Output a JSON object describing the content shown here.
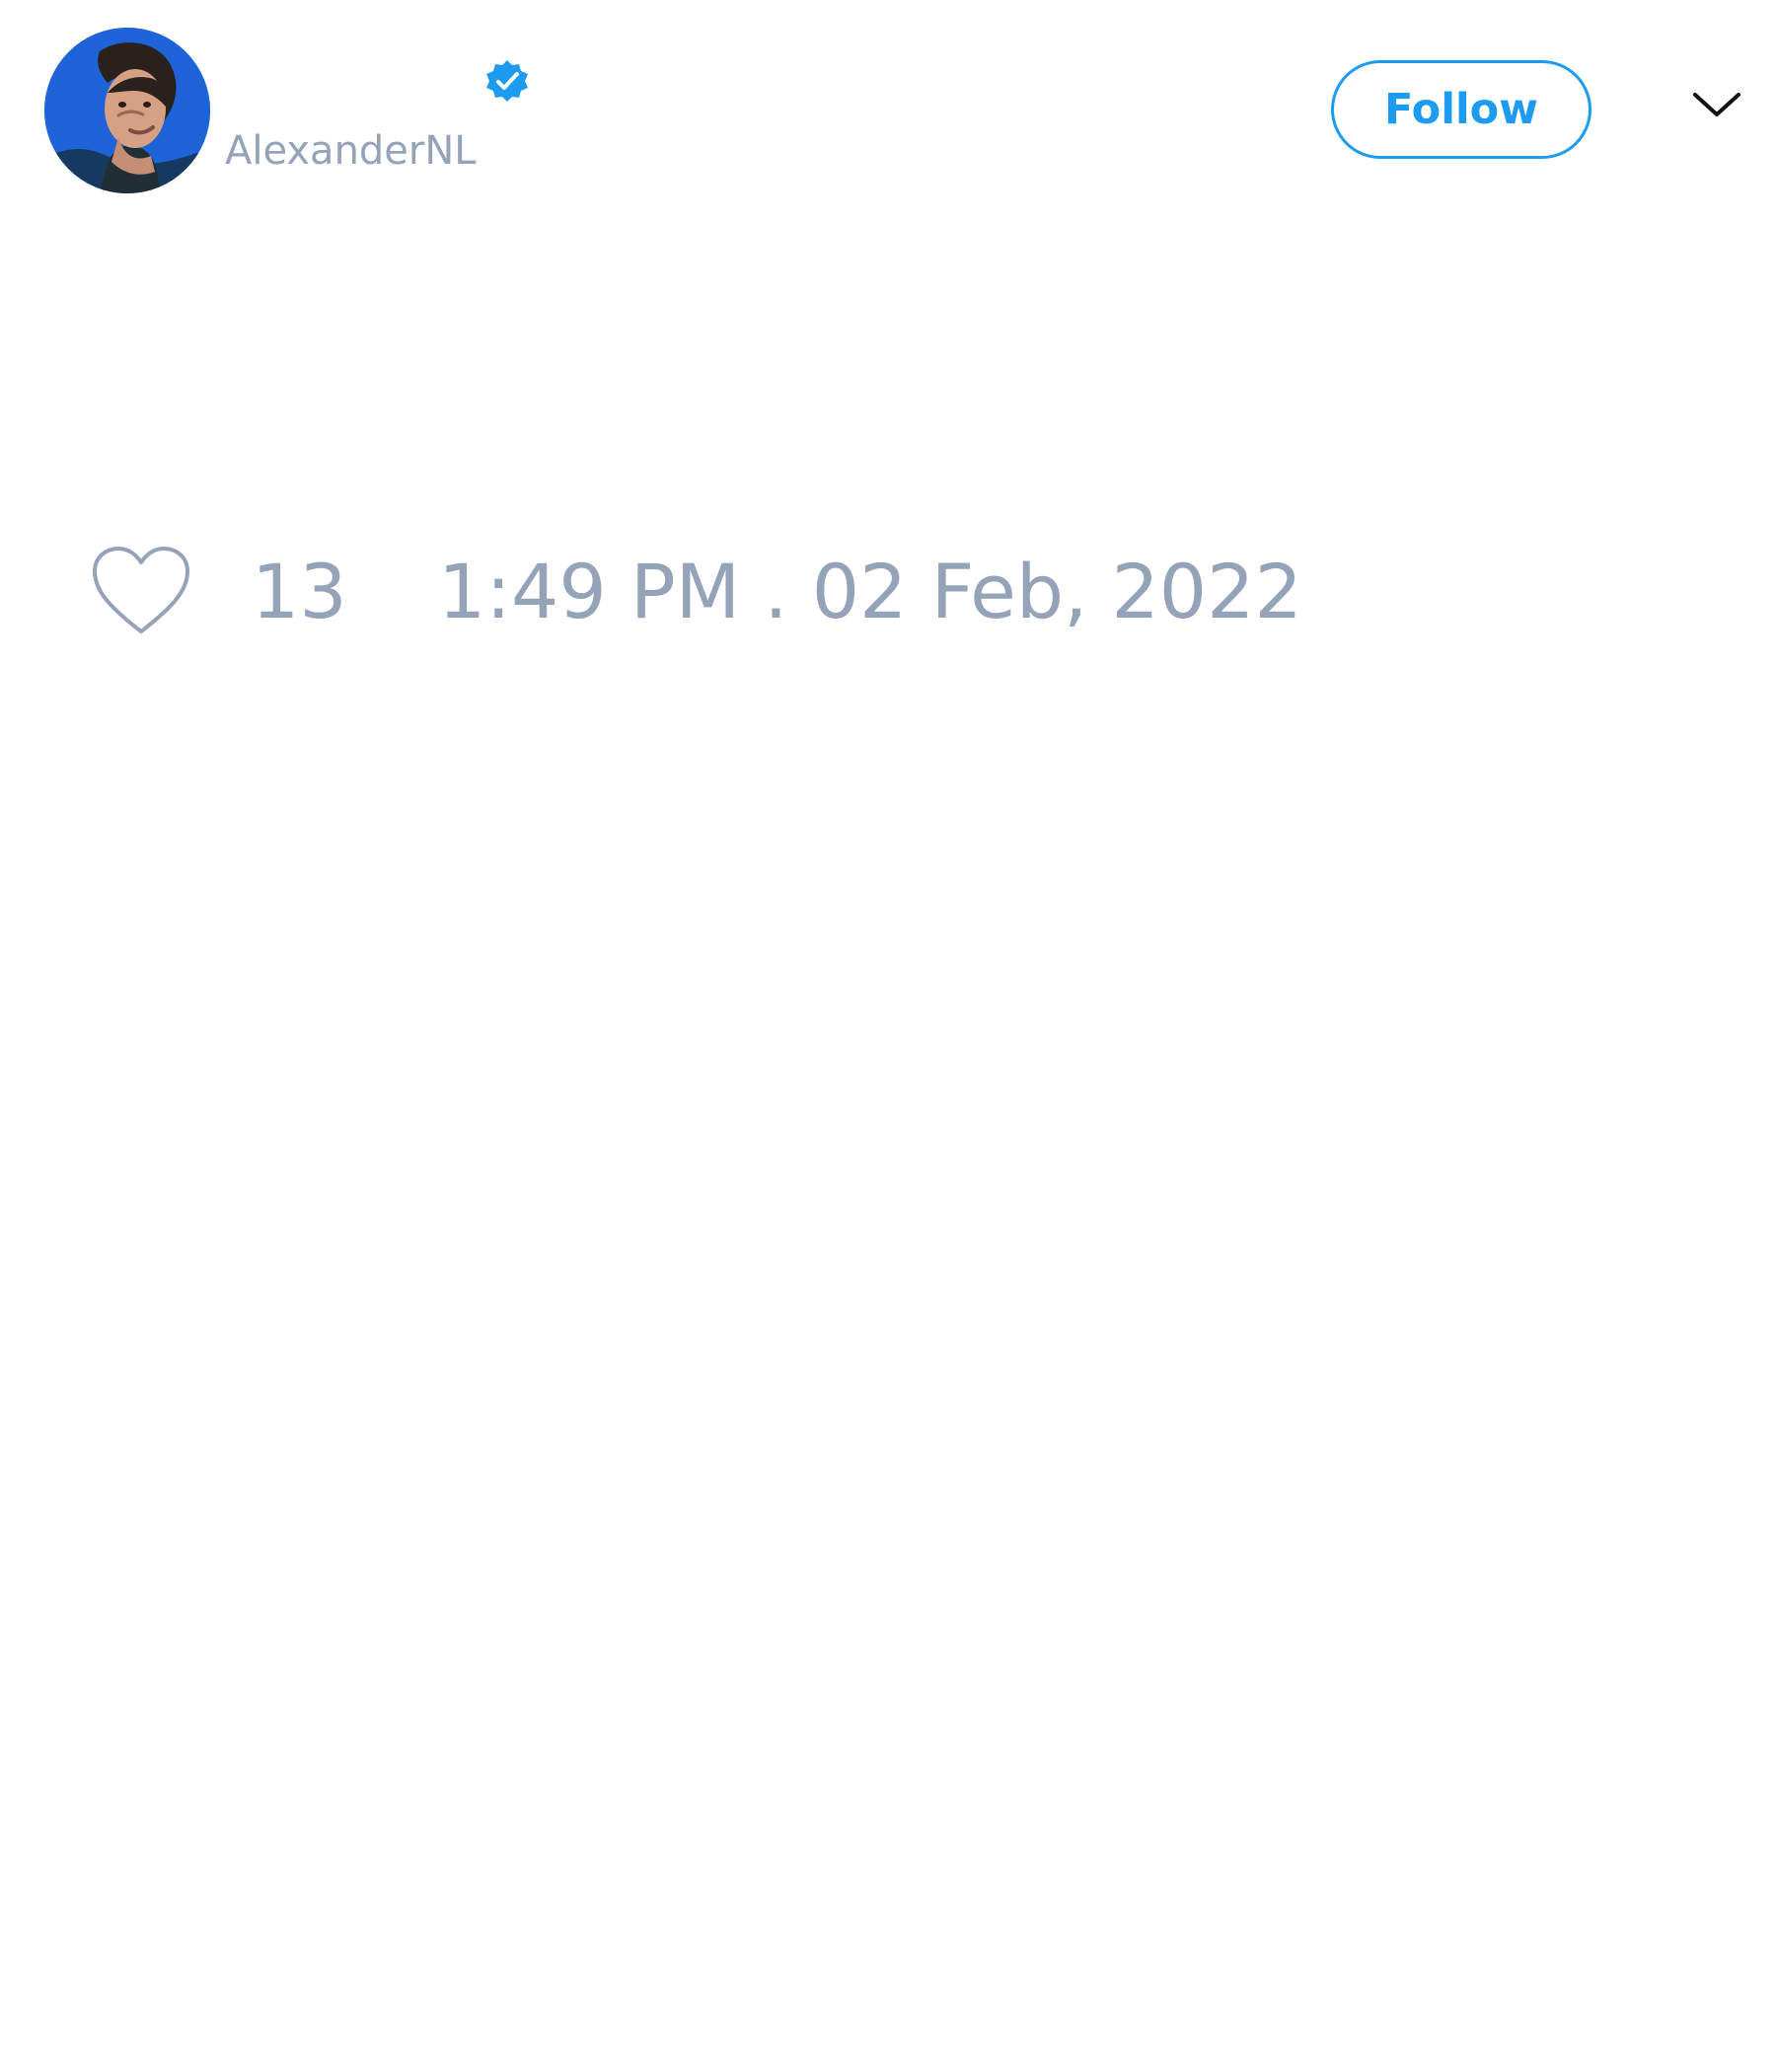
{
  "tweet": {
    "author": {
      "display_name": "",
      "handle": "AlexanderNL",
      "verified": true,
      "avatar_icon": "user-avatar"
    },
    "follow_label": "Follow",
    "more_icon": "chevron-down-icon",
    "like_icon": "heart-icon",
    "like_count": "13",
    "timestamp": "1:49 PM . 02 Feb, 2022"
  },
  "colors": {
    "accent": "#1d9bf0",
    "muted_text": "#94a3b8",
    "avatar_background": "#1f63d8",
    "icon_dark": "#0f1419"
  }
}
